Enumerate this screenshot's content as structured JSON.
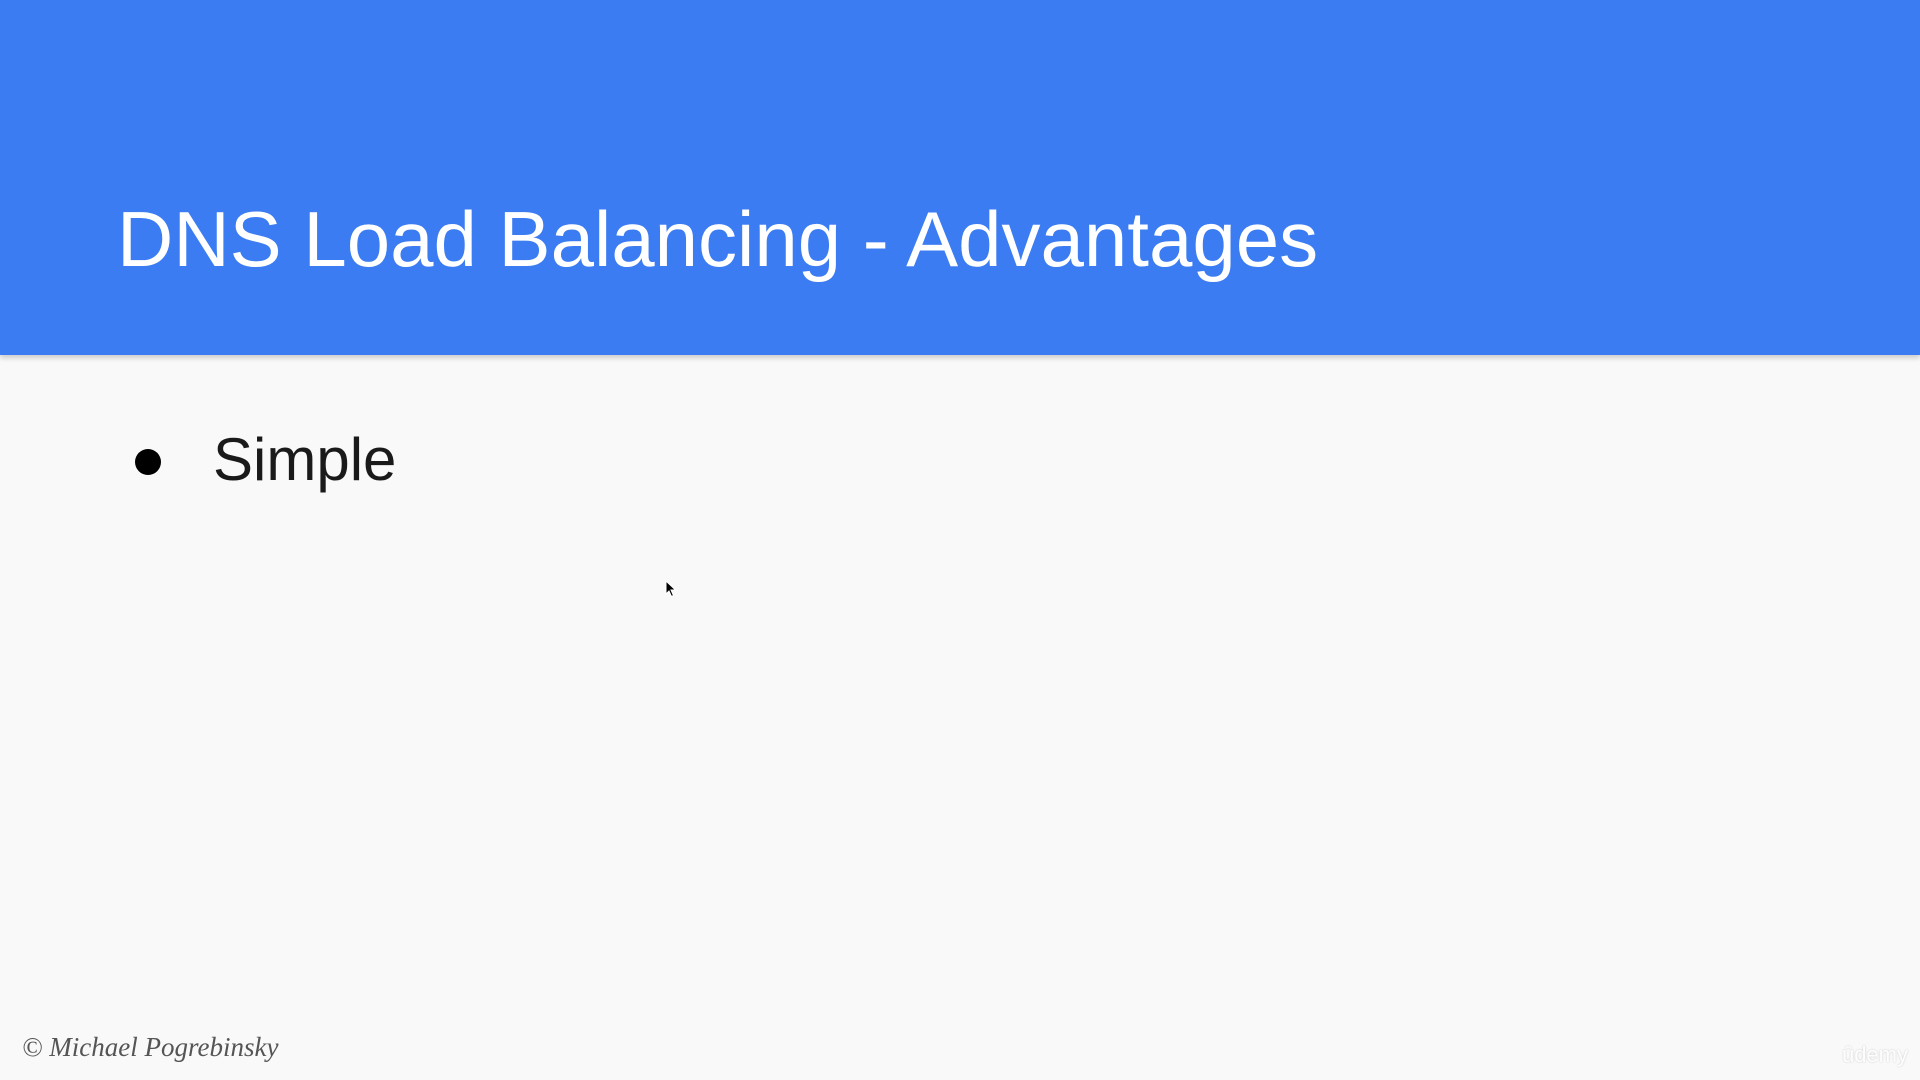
{
  "slide": {
    "title": "DNS Load Balancing - Advantages",
    "bullets": [
      {
        "text": "Simple"
      }
    ],
    "copyright": "© Michael Pogrebinsky",
    "watermark": "ûdemy"
  },
  "theme": {
    "header_color": "#3b7cf2",
    "background_color": "#f9f9f9",
    "title_color": "#ffffff",
    "bullet_color": "#000000"
  },
  "icons": {
    "bullet": "filled-circle-bullet-icon",
    "cursor": "mouse-pointer-icon"
  }
}
